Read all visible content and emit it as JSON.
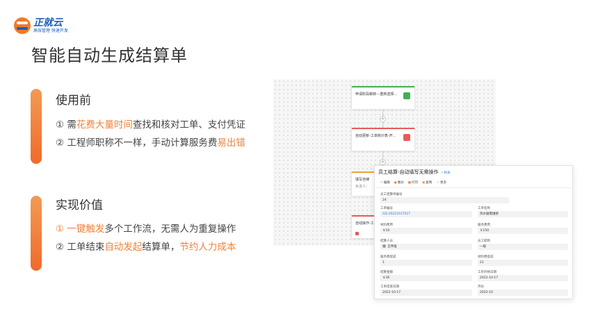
{
  "logo": {
    "name": "正就云",
    "slogan": "高效管理 快速开发"
  },
  "title": "智能自动生成结算单",
  "sections": [
    {
      "title": "使用前",
      "lines": [
        [
          {
            "t": "① 需",
            "hl": false
          },
          {
            "t": "花费大量时间",
            "hl": true
          },
          {
            "t": "查找和核对工单、支付凭证",
            "hl": false
          }
        ],
        [
          {
            "t": "② 工程师职称不一样，手动计算服务费",
            "hl": false
          },
          {
            "t": "易出错",
            "hl": true
          }
        ]
      ]
    },
    {
      "title": "实现价值",
      "lines": [
        [
          {
            "t": "① 一键触发",
            "hl": true
          },
          {
            "t": "多个工作流，无需人为重复操作",
            "hl": false
          }
        ],
        [
          {
            "t": "② 工单结束",
            "hl": false
          },
          {
            "t": "自动发起",
            "hl": true
          },
          {
            "t": "结算单，",
            "hl": false
          },
          {
            "t": "节约人力成本",
            "hl": true
          }
        ]
      ]
    }
  ],
  "flow": {
    "cards": [
      "申请阶段跳转---重新选择...",
      "自动更新-工单统计表-开...",
      "填写自律",
      "自动操作-工..."
    ],
    "card3_sub": "负责人："
  },
  "panel": {
    "title": "员工结算-自动填写无需操作",
    "tag": "• 附表",
    "toolbar": [
      "编辑",
      "催办",
      "打印",
      "复制",
      "··· 更多"
    ],
    "fields": [
      {
        "label": "员工结算单编号",
        "value": "24"
      },
      {
        "label": "工单编号",
        "value": "GD-20221017027",
        "link": true
      },
      {
        "label": "工单名称",
        "value": "热水器需维修"
      },
      {
        "label": "材料费用",
        "value": "￥10"
      },
      {
        "label": "服务费用",
        "value": "￥150"
      },
      {
        "label": "结算人员",
        "value": "王伟强",
        "avatar": true
      },
      {
        "label": "员工职称",
        "value": "一级"
      },
      {
        "label": "服务费提成",
        "value": "1"
      },
      {
        "label": "材料费提成",
        "value": "21"
      },
      {
        "label": "结算金额",
        "value": "￥36"
      },
      {
        "label": "工单开始日期",
        "value": "2022-10-17"
      },
      {
        "label": "工单结束日期",
        "value": "2022-10-17"
      },
      {
        "label": "月份",
        "value": "2022-10"
      }
    ]
  },
  "colors": {
    "accent": "#f0823a",
    "brand": "#1f5fb8"
  }
}
